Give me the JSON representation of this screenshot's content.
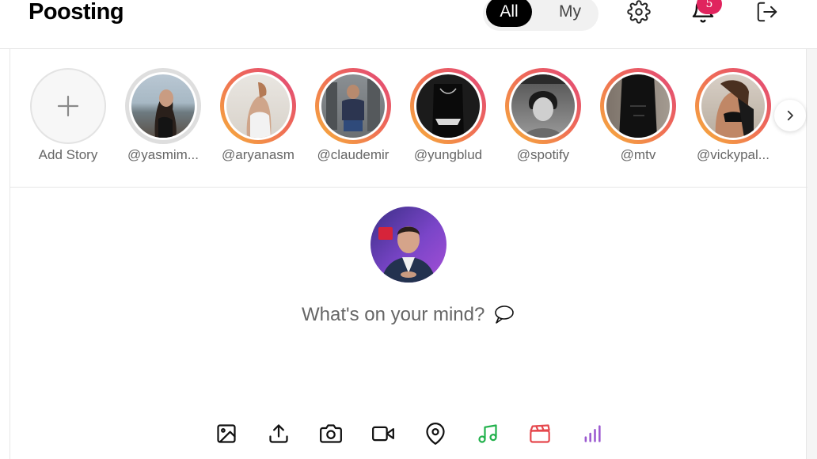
{
  "app": {
    "title": "Poosting"
  },
  "feed_toggle": {
    "all_label": "All",
    "my_label": "My",
    "selected": "All"
  },
  "header_icons": {
    "settings": "gear-icon",
    "notifications": "bell-icon",
    "logout": "logout-icon"
  },
  "notifications": {
    "count": "5"
  },
  "stories": {
    "add_label": "Add Story",
    "items": [
      {
        "handle": "@yasmim...",
        "seen": true
      },
      {
        "handle": "@aryanasm",
        "seen": false
      },
      {
        "handle": "@claudemir",
        "seen": false
      },
      {
        "handle": "@yungblud",
        "seen": false
      },
      {
        "handle": "@spotify",
        "seen": false
      },
      {
        "handle": "@mtv",
        "seen": false
      },
      {
        "handle": "@vickypal...",
        "seen": false
      }
    ],
    "next_icon": "chevron-right-icon"
  },
  "composer": {
    "prompt": "What's on your mind?",
    "prompt_icon": "thought-bubble-icon",
    "tools": [
      {
        "name": "image-icon",
        "color": "#111111"
      },
      {
        "name": "upload-icon",
        "color": "#111111"
      },
      {
        "name": "camera-icon",
        "color": "#111111"
      },
      {
        "name": "video-icon",
        "color": "#111111"
      },
      {
        "name": "location-icon",
        "color": "#111111"
      },
      {
        "name": "music-icon",
        "color": "#22b14c"
      },
      {
        "name": "clapperboard-icon",
        "color": "#e5484d"
      },
      {
        "name": "poll-icon",
        "color": "#9b59d0"
      }
    ]
  },
  "colors": {
    "accent": "#000000",
    "badge": "#e0245e",
    "story_ring_start": "#f6b13a",
    "story_ring_end": "#e0457b"
  }
}
